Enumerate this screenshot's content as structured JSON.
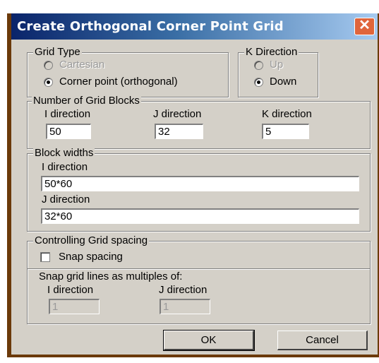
{
  "window": {
    "title": "Create Orthogonal Corner Point Grid",
    "close_glyph": "✕"
  },
  "grid_type": {
    "legend": "Grid Type",
    "options": [
      {
        "label": "Cartesian",
        "selected": false,
        "enabled": false
      },
      {
        "label": "Corner point (orthogonal)",
        "selected": true,
        "enabled": true
      }
    ]
  },
  "k_direction": {
    "legend": "K Direction",
    "options": [
      {
        "label": "Up",
        "selected": false,
        "enabled": false
      },
      {
        "label": "Down",
        "selected": true,
        "enabled": true
      }
    ]
  },
  "grid_blocks": {
    "legend": "Number of Grid Blocks",
    "i_label": "I direction",
    "i_value": "50",
    "j_label": "J direction",
    "j_value": "32",
    "k_label": "K direction",
    "k_value": "5"
  },
  "block_widths": {
    "legend": "Block widths",
    "i_label": "I direction",
    "i_value": "50*60",
    "j_label": "J direction",
    "j_value": "32*60"
  },
  "spacing": {
    "legend": "Controlling Grid spacing",
    "snap_label": "Snap spacing",
    "snap_checked": false,
    "multiples_label": "Snap grid lines as multiples of:",
    "i_label": "I direction",
    "i_value": "1",
    "j_label": "J direction",
    "j_value": "1"
  },
  "buttons": {
    "ok": "OK",
    "cancel": "Cancel"
  }
}
